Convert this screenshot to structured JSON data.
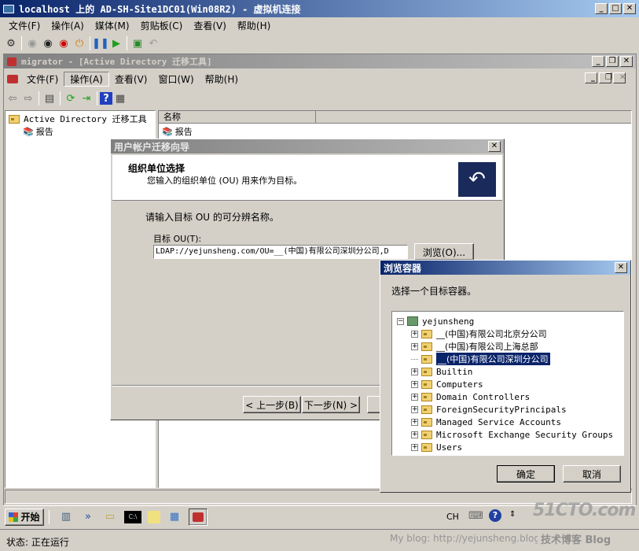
{
  "vm_window": {
    "title": "localhost 上的 AD-SH-Site1DC01(Win08R2) - 虚拟机连接",
    "menu": [
      "文件(F)",
      "操作(A)",
      "媒体(M)",
      "剪贴板(C)",
      "查看(V)",
      "帮助(H)"
    ]
  },
  "mmc_window": {
    "title": "migrator - [Active Directory 迁移工具]",
    "menu": [
      "文件(F)",
      "操作(A)",
      "查看(V)",
      "窗口(W)",
      "帮助(H)"
    ],
    "tree_root": "Active Directory 迁移工具",
    "tree_child": "报告",
    "column_header": "名称",
    "list_item": "报告"
  },
  "wizard": {
    "title": "用户帐户迁移向导",
    "heading": "组织单位选择",
    "subheading": "您输入的组织单位 (OU) 用来作为目标。",
    "instruction": "请输入目标 OU 的可分辨名称。",
    "field_label": "目标 OU(T):",
    "field_value": "LDAP://yejunsheng.com/OU=__(中国)有限公司深圳分公司,D",
    "browse_label": "浏览(O)...",
    "back_label": "< 上一步(B)",
    "next_label": "下一步(N) >"
  },
  "browse_dialog": {
    "title": "浏览容器",
    "prompt": "选择一个目标容器。",
    "root": "yejunsheng",
    "items": [
      "__(中国)有限公司北京分公司",
      "__(中国)有限公司上海总部",
      "__(中国)有限公司深圳分公司",
      "Builtin",
      "Computers",
      "Domain Controllers",
      "ForeignSecurityPrincipals",
      "Managed Service Accounts",
      "Microsoft Exchange Security Groups",
      "Users"
    ],
    "ok_label": "确定",
    "cancel_label": "取消"
  },
  "taskbar": {
    "start_label": "开始",
    "lang": "CH"
  },
  "statusbar": {
    "status": "状态: 正在运行"
  },
  "watermark": {
    "brand": "51CTO.com",
    "blog": "My blog: http://yejunsheng.blog.51cto.com",
    "tagline": "技术博客 Blog"
  }
}
